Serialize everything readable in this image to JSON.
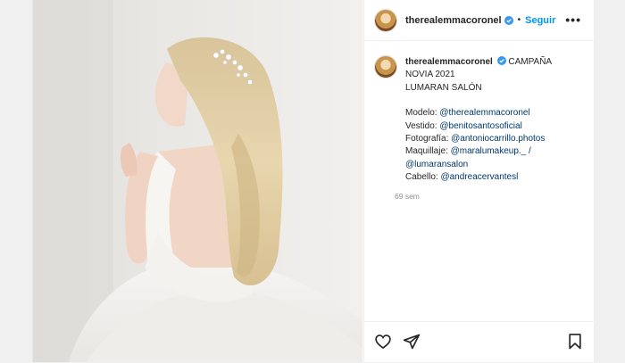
{
  "header": {
    "username": "therealemmacoronel",
    "separator": "•",
    "follow_label": "Seguir",
    "more_label": "•••"
  },
  "caption": {
    "username": "therealemmacoronel",
    "lines": [
      "CAMPAÑA",
      "NOVIA 2021",
      "LUMARAN SALÓN"
    ],
    "credits": [
      {
        "label": "Modelo: ",
        "handle": "@therealemmacoronel"
      },
      {
        "label": "Vestido: ",
        "handle": "@benitosantosoficial"
      },
      {
        "label": "Fotografía: ",
        "handle": "@antoniocarrillo.photos"
      },
      {
        "label": "Maquillaje: ",
        "handle": "@maralumakeup._ /"
      },
      {
        "label": "",
        "handle": "@lumaransalon"
      },
      {
        "label": "Cabello: ",
        "handle": "@andreacervantesl"
      }
    ],
    "time": "69 sem"
  },
  "icons": {
    "verified": "verified-badge-icon",
    "like": "heart-icon",
    "share": "paper-plane-icon",
    "save": "bookmark-icon"
  },
  "colors": {
    "accent": "#0095f6",
    "verified": "#3897f0",
    "link": "#00376b",
    "muted": "#8e8e8e"
  }
}
